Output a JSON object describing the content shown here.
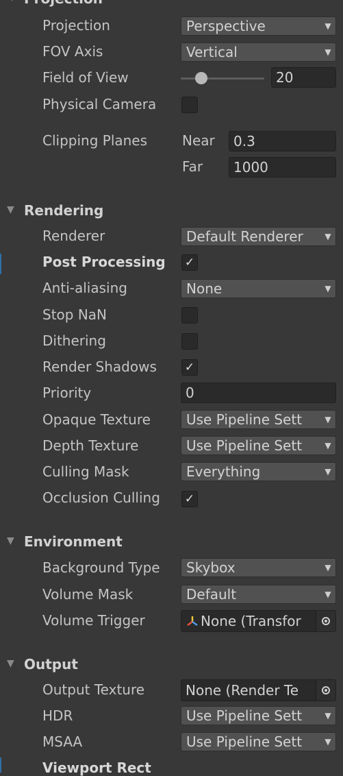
{
  "projection": {
    "title": "Projection",
    "projection_label": "Projection",
    "projection_value": "Perspective",
    "fov_axis_label": "FOV Axis",
    "fov_axis_value": "Vertical",
    "fov_label": "Field of View",
    "fov_value": "20",
    "physical_camera_label": "Physical Camera",
    "clipping_label": "Clipping Planes",
    "near_label": "Near",
    "near_value": "0.3",
    "far_label": "Far",
    "far_value": "1000"
  },
  "rendering": {
    "title": "Rendering",
    "renderer_label": "Renderer",
    "renderer_value": "Default Renderer",
    "post_processing_label": "Post Processing",
    "anti_aliasing_label": "Anti-aliasing",
    "anti_aliasing_value": "None",
    "stop_nan_label": "Stop NaN",
    "dithering_label": "Dithering",
    "render_shadows_label": "Render Shadows",
    "priority_label": "Priority",
    "priority_value": "0",
    "opaque_texture_label": "Opaque Texture",
    "opaque_texture_value": "Use Pipeline Sett",
    "depth_texture_label": "Depth Texture",
    "depth_texture_value": "Use Pipeline Sett",
    "culling_mask_label": "Culling Mask",
    "culling_mask_value": "Everything",
    "occlusion_culling_label": "Occlusion Culling"
  },
  "environment": {
    "title": "Environment",
    "background_type_label": "Background Type",
    "background_type_value": "Skybox",
    "volume_mask_label": "Volume Mask",
    "volume_mask_value": "Default",
    "volume_trigger_label": "Volume Trigger",
    "volume_trigger_value": "None (Transfor"
  },
  "output": {
    "title": "Output",
    "output_texture_label": "Output Texture",
    "output_texture_value": "None (Render Te",
    "hdr_label": "HDR",
    "hdr_value": "Use Pipeline Sett",
    "msaa_label": "MSAA",
    "msaa_value": "Use Pipeline Sett",
    "viewport_rect_label": "Viewport Rect"
  },
  "checkboxes": {
    "physical_camera": false,
    "post_processing": true,
    "stop_nan": false,
    "dithering": false,
    "render_shadows": true,
    "occlusion_culling": true
  },
  "fov_slider": {
    "min": 1,
    "max": 179,
    "value": 20
  },
  "icons": {
    "dropdown": "caret-down-icon",
    "check": "checkmark-icon",
    "foldout": "foldout-arrow-icon",
    "picker": "object-picker-icon",
    "transform": "transform-icon"
  }
}
